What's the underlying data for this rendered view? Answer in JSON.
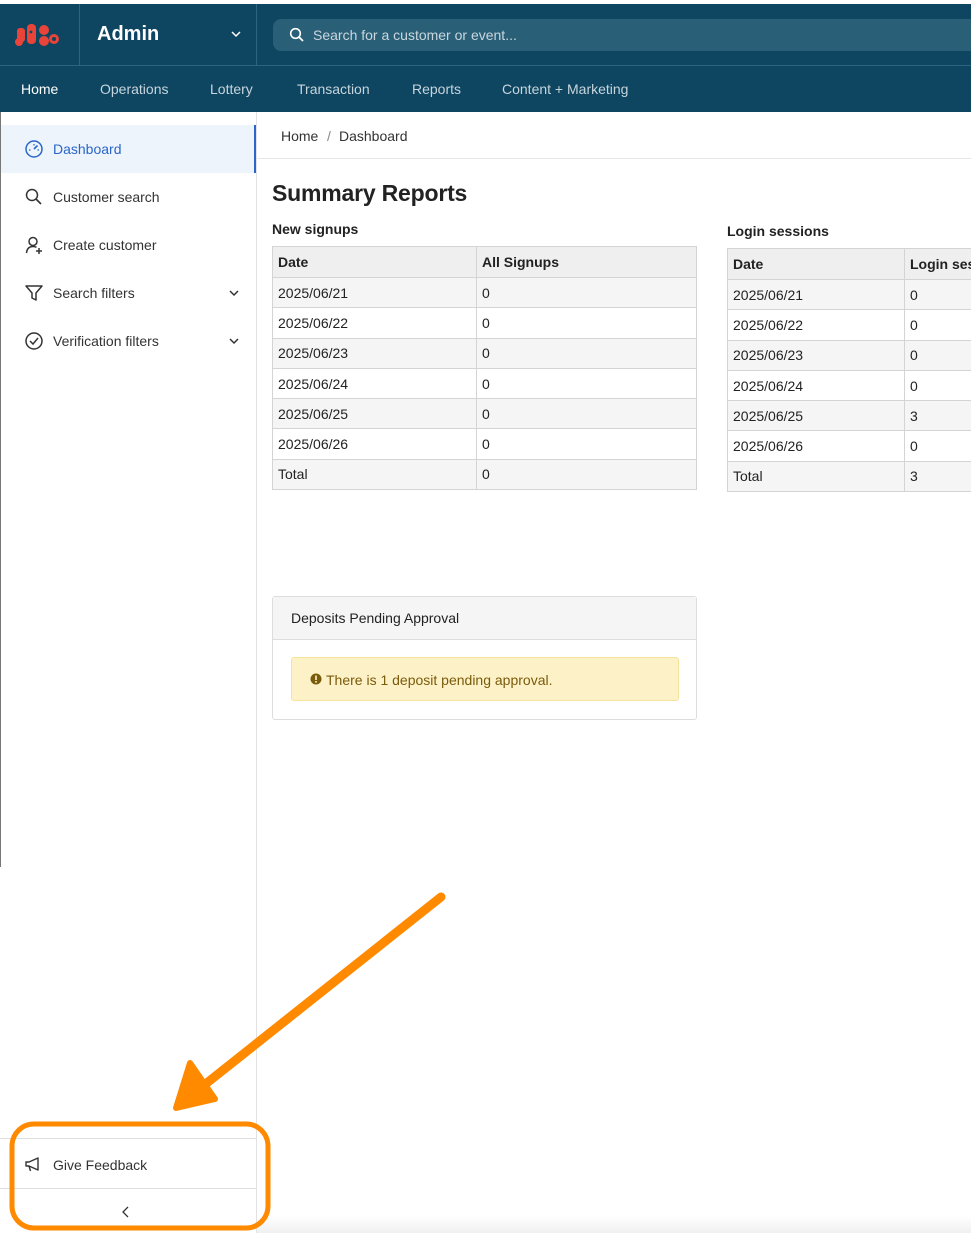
{
  "header": {
    "logo_alt": "JUMBO",
    "brand": "Admin",
    "search_placeholder": "Search for a customer or event...",
    "brand_color": "#0e4560",
    "logo_color": "#e8443a"
  },
  "nav": {
    "items": [
      "Home",
      "Operations",
      "Lottery",
      "Transaction",
      "Reports",
      "Content + Marketing"
    ],
    "active": "Home"
  },
  "sidebar": {
    "items": [
      {
        "label": "Dashboard",
        "icon": "dashboard-icon",
        "active": true
      },
      {
        "label": "Customer search",
        "icon": "search-icon"
      },
      {
        "label": "Create customer",
        "icon": "user-add-icon"
      },
      {
        "label": "Search filters",
        "icon": "filter-icon",
        "expandable": true
      },
      {
        "label": "Verification filters",
        "icon": "check-circle-icon",
        "expandable": true
      }
    ],
    "feedback": "Give Feedback",
    "collapse_glyph": "<"
  },
  "breadcrumb": {
    "home": "Home",
    "separator": "/",
    "current": "Dashboard"
  },
  "page_title": "Summary Reports",
  "signups": {
    "title": "New signups",
    "columns": [
      "Date",
      "All Signups"
    ],
    "rows": [
      [
        "2025/06/21",
        "0"
      ],
      [
        "2025/06/22",
        "0"
      ],
      [
        "2025/06/23",
        "0"
      ],
      [
        "2025/06/24",
        "0"
      ],
      [
        "2025/06/25",
        "0"
      ],
      [
        "2025/06/26",
        "0"
      ],
      [
        "Total",
        "0"
      ]
    ]
  },
  "logins": {
    "title": "Login sessions",
    "columns": [
      "Date",
      "Login ses"
    ],
    "rows": [
      [
        "2025/06/21",
        "0"
      ],
      [
        "2025/06/22",
        "0"
      ],
      [
        "2025/06/23",
        "0"
      ],
      [
        "2025/06/24",
        "0"
      ],
      [
        "2025/06/25",
        "3"
      ],
      [
        "2025/06/26",
        "0"
      ],
      [
        "Total",
        "3"
      ]
    ]
  },
  "deposits": {
    "title": "Deposits Pending Approval",
    "message": "There is 1 deposit pending approval.",
    "alert_color": "#fdf2c7"
  },
  "annotation": {
    "color": "#ff8a00"
  }
}
